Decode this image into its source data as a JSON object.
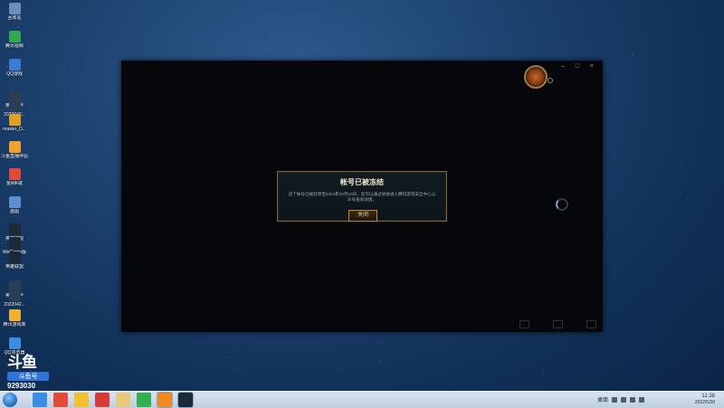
{
  "desktop": {
    "icons": [
      {
        "label": "回收站",
        "color": "#6a8fb8"
      },
      {
        "label": "腾讯视频",
        "color": "#2fa84f"
      },
      {
        "label": "QQ游戏",
        "color": "#3a7bd5"
      },
      {
        "label": "英雄盟卢",
        "color": "#2a3f55"
      },
      {
        "label": "2022042...",
        "color": "#2a3f55"
      },
      {
        "label": "master_D...",
        "color": "#e0a020"
      },
      {
        "label": "斗鱼直播伴侣",
        "color": "#f0a030"
      },
      {
        "label": "金网K歌",
        "color": "#e24a3a"
      },
      {
        "label": "画图",
        "color": "#5c8fd0"
      },
      {
        "label": "英雄联盟",
        "color": "#1d2a36"
      },
      {
        "label": "WeGame版",
        "color": "#1d2a36"
      },
      {
        "label": "英雄联盟",
        "color": "#1d2a36"
      },
      {
        "label": "英雄盟卢",
        "color": "#2a3f55"
      },
      {
        "label": "2022042...",
        "color": "#2a3f55"
      },
      {
        "label": "腾讯游戏库",
        "color": "#f0b030"
      },
      {
        "label": "QQ浏览器",
        "color": "#3a8de0"
      }
    ]
  },
  "watermark": {
    "logo": "斗鱼",
    "tag": "斗鱼号",
    "room": "9293030"
  },
  "window": {
    "controls": {
      "minimize": "–",
      "maximize": "□",
      "close": "×"
    }
  },
  "dialog": {
    "title": "帐号已被冻结",
    "message": "这个帐号已被封停至2024年03月10日，您可以通过依依进入腾讯游戏安全中心公众号查询详情。",
    "close_label": "关闭"
  },
  "taskbar": {
    "apps": [
      {
        "name": "ie-app",
        "color": "#3a8de0"
      },
      {
        "name": "search-app",
        "color": "#e24a3a"
      },
      {
        "name": "qq-app",
        "color": "#f0c030"
      },
      {
        "name": "netease-music-app",
        "color": "#d83a3a"
      },
      {
        "name": "folder-app",
        "color": "#e8c87a"
      },
      {
        "name": "media-player-app",
        "color": "#30b050"
      },
      {
        "name": "douyu-app",
        "color": "#f08a20"
      },
      {
        "name": "lol-app",
        "color": "#1d2a36"
      }
    ],
    "tray_text": "桌面",
    "clock_time": "11:38",
    "clock_date": "2022/5/30"
  }
}
